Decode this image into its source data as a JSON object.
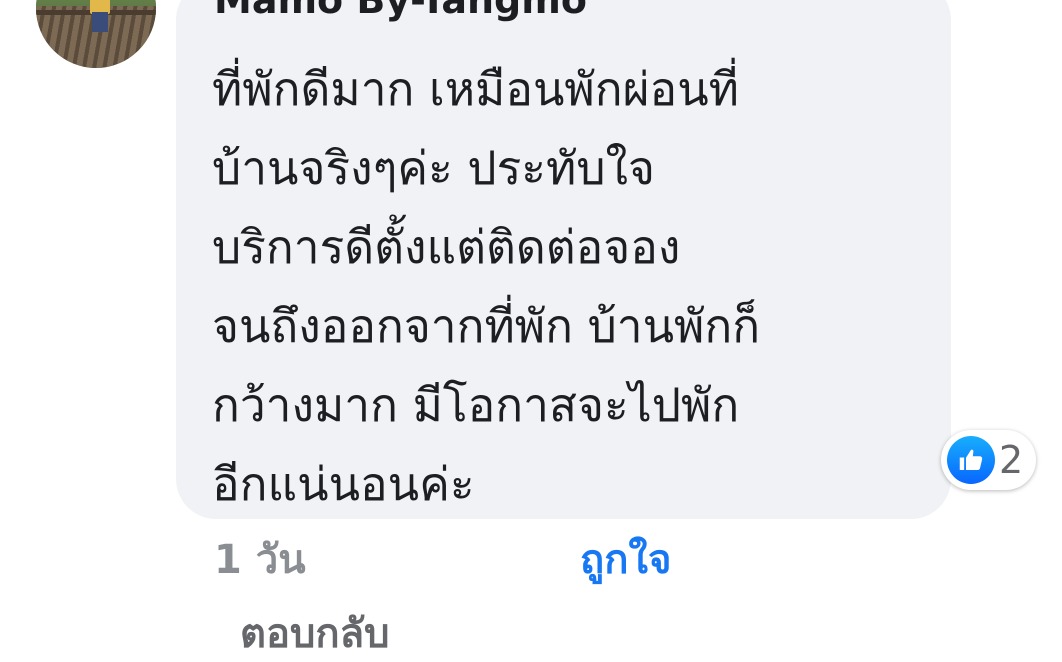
{
  "comment": {
    "author_name": "Mamo By-Tangmo",
    "text_lines": [
      "ที่พักดีมาก เหมือนพักผ่อนที่",
      "บ้านจริงๆค่ะ ประทับใจ",
      "บริการดีตั้งแต่ติดต่อจอง",
      "จนถึงออกจากที่พัก บ้านพักก็",
      "กว้างมาก มีโอกาสจะไปพัก",
      "อีกแน่นอนค่ะ"
    ],
    "reaction": {
      "icon": "thumbs-up-icon",
      "count": "2",
      "color": "#1877f2"
    }
  },
  "actions": {
    "timestamp": "1 วัน",
    "like_label": "ถูกใจ",
    "reply_label": "ตอบกลับ"
  },
  "colors": {
    "bubble_background": "#f0f2f5",
    "link_blue": "#1877f2",
    "muted_gray": "#65676b"
  }
}
